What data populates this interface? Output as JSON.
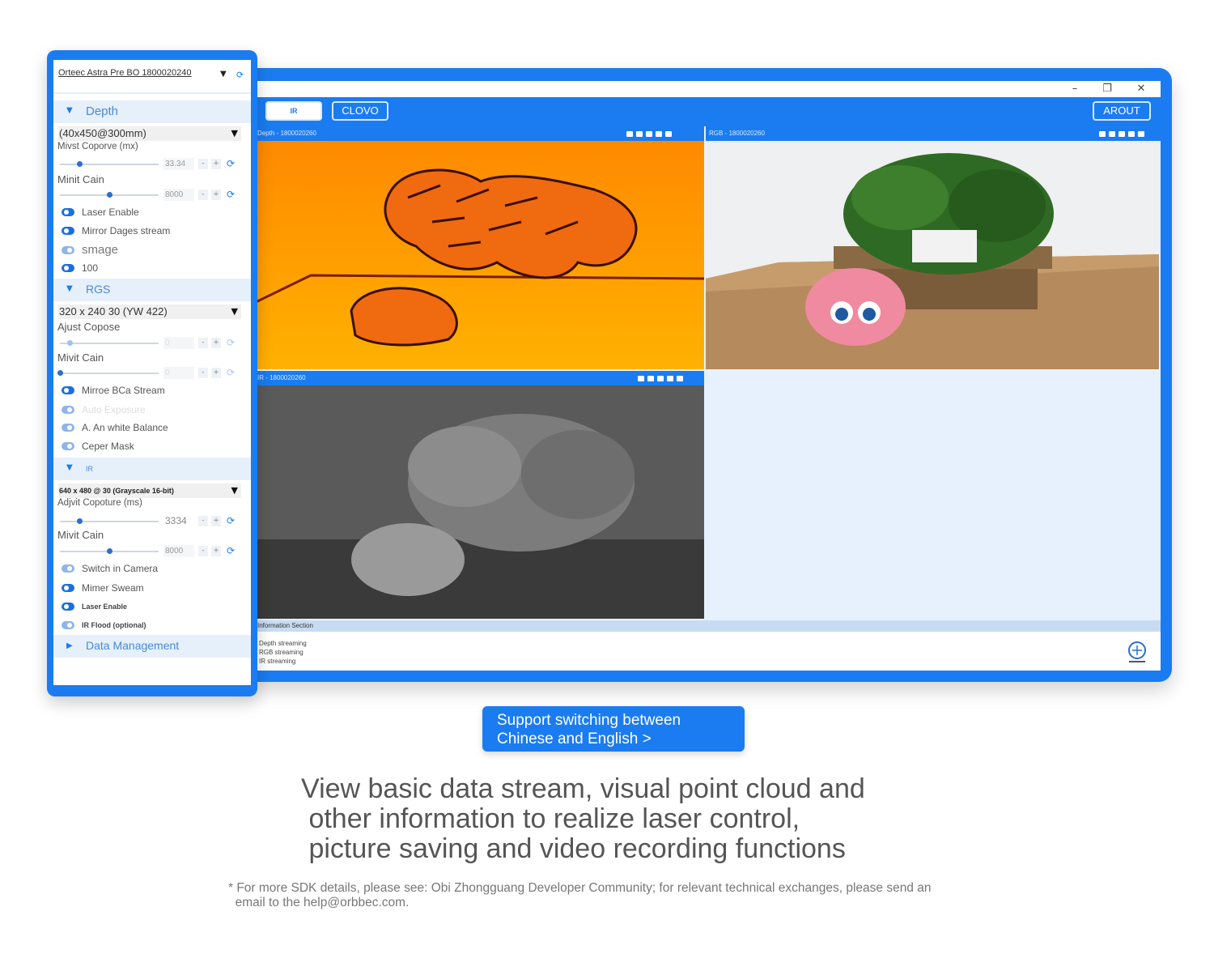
{
  "window": {
    "controls": [
      "–",
      "❐",
      "✕"
    ],
    "toolbar": {
      "tabs": [
        "IR",
        "CLOVO"
      ],
      "about_label": "AROUT"
    },
    "panels": {
      "depth_header": "Depth - 1800020260",
      "rgb_header": "RGB - 1800020260",
      "ir_header": "IR - 1800020260"
    },
    "info": {
      "header": "Information Section",
      "lines": [
        "Depth streaming",
        "RGB streaming",
        "IR streaming"
      ]
    }
  },
  "sidebar": {
    "device": "Orteec Astra Pre BO 1800020240",
    "depth": {
      "title": "Depth",
      "mode": "(40x450@300mm)",
      "exposure_label": "Mivst Coporve (mx)",
      "exposure_value": "33.34",
      "exposure_level": 0.2,
      "gain_label": "Minit Cain",
      "gain_value": "8000",
      "gain_level": 0.5,
      "toggles": [
        {
          "label": "Laser Enable",
          "on": true
        },
        {
          "label": "Mirror Dages stream",
          "on": true
        },
        {
          "label": "smage",
          "on": false
        },
        {
          "label": "100",
          "on": true
        }
      ]
    },
    "rgb": {
      "title": "RGS",
      "mode": "320 x 240 30 (YW 422)",
      "exposure_label": "Ajust Copose",
      "exposure_value": "0",
      "exposure_level": 0.1,
      "gain_label": "Mivit Cain",
      "gain_value": "0",
      "gain_level": 0.0,
      "toggles": [
        {
          "label": "Mirroe BCa Stream",
          "on": true
        },
        {
          "label": "Auto Exposure",
          "on": false
        },
        {
          "label": "A. An white Balance",
          "on": false
        },
        {
          "label": "Ceper Mask",
          "on": false
        }
      ]
    },
    "ir": {
      "title": "IR",
      "mode": "640 x 480 @ 30 (Grayscale 16-bit)",
      "exposure_label": "Adjvit Copoture (ms)",
      "exposure_value": "3334",
      "exposure_level": 0.2,
      "gain_label": "Mivit Cain",
      "gain_value": "8000",
      "gain_level": 0.5,
      "toggles": [
        {
          "label": "Switch in Camera",
          "on": false
        },
        {
          "label": "Mimer Sweam",
          "on": true
        },
        {
          "label": "Laser Enable",
          "on": true
        },
        {
          "label": "IR Flood (optional)",
          "on": false
        }
      ]
    },
    "data_management": "Data Management"
  },
  "captions": {
    "lang_button": [
      "Support switching between",
      "Chinese and English >"
    ],
    "headline": [
      "View basic data stream, visual point cloud and",
      " other information to realize laser control,",
      " picture saving and video recording functions"
    ],
    "footnote": [
      "* For more SDK details, please see: Obi Zhongguang Developer Community; for relevant technical exchanges, please send an",
      "  email to the help@orbbec.com."
    ]
  },
  "colors": {
    "accent": "#1a7cf0",
    "panel_bg": "#e6f1fd",
    "depth_orange": "#ff8a00",
    "depth_dark": "#c83a00"
  }
}
